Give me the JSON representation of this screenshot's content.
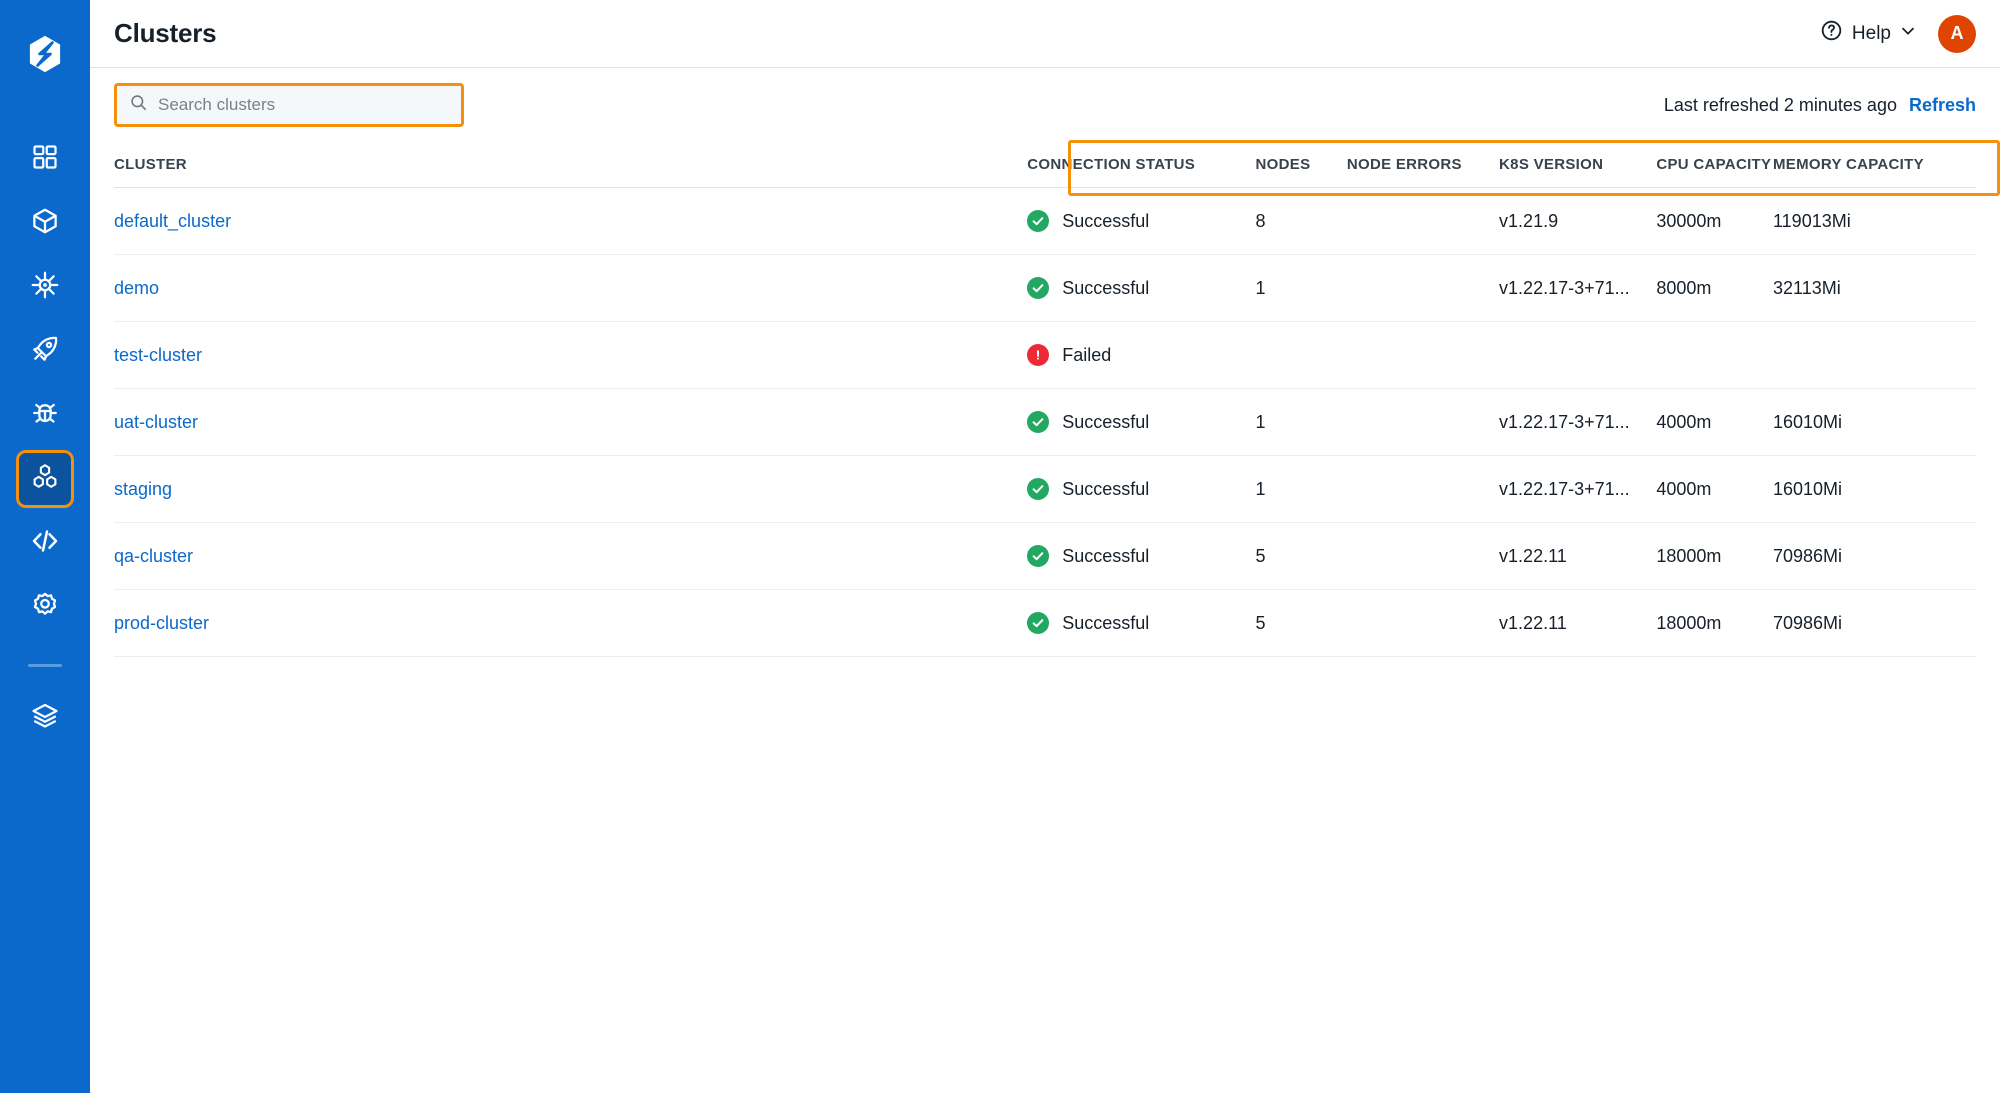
{
  "app": {
    "logo_icon": "hexagon-bolt-logo",
    "accent_blue": "#0b69cc",
    "highlight_orange": "#f5900c",
    "status_green": "#23a863",
    "status_red": "#ec2a37",
    "avatar_color": "#e04403"
  },
  "sidebar": {
    "items": [
      {
        "id": "dashboard",
        "icon": "grid-squares-icon",
        "active": false
      },
      {
        "id": "applications",
        "icon": "cube-icon",
        "active": false
      },
      {
        "id": "observe",
        "icon": "helm-wheel-icon",
        "active": false
      },
      {
        "id": "deploy",
        "icon": "rocket-icon",
        "active": false
      },
      {
        "id": "debug",
        "icon": "bug-icon",
        "active": false
      },
      {
        "id": "clusters",
        "icon": "hexagons-icon",
        "active": true
      },
      {
        "id": "code",
        "icon": "code-brackets-icon",
        "active": false
      },
      {
        "id": "settings",
        "icon": "gear-icon",
        "active": false
      },
      {
        "id": "stacks",
        "icon": "layers-icon",
        "active": false
      }
    ]
  },
  "header": {
    "title": "Clusters",
    "help_label": "Help",
    "help_icon": "question-circle-icon",
    "help_chevron_icon": "chevron-down-icon",
    "avatar_initial": "A"
  },
  "search": {
    "placeholder": "Search clusters",
    "value": "",
    "icon": "search-icon"
  },
  "refresh": {
    "last_refreshed_text": "Last refreshed 2 minutes ago",
    "refresh_label": "Refresh"
  },
  "table": {
    "columns": [
      {
        "key": "cluster",
        "label": "CLUSTER"
      },
      {
        "key": "connection",
        "label": "CONNECTION STATUS"
      },
      {
        "key": "nodes",
        "label": "NODES"
      },
      {
        "key": "node_errors",
        "label": "NODE ERRORS"
      },
      {
        "key": "k8s_version",
        "label": "K8S VERSION"
      },
      {
        "key": "cpu_capacity",
        "label": "CPU CAPACITY"
      },
      {
        "key": "memory_capacity",
        "label": "MEMORY CAPACITY"
      }
    ],
    "rows": [
      {
        "cluster": "default_cluster",
        "connection": "Successful",
        "status": "ok",
        "nodes": "8",
        "node_errors": "",
        "k8s_version": "v1.21.9",
        "cpu_capacity": "30000m",
        "memory_capacity": "119013Mi"
      },
      {
        "cluster": "demo",
        "connection": "Successful",
        "status": "ok",
        "nodes": "1",
        "node_errors": "",
        "k8s_version": "v1.22.17-3+71...",
        "cpu_capacity": "8000m",
        "memory_capacity": "32113Mi"
      },
      {
        "cluster": "test-cluster",
        "connection": "Failed",
        "status": "fail",
        "nodes": "",
        "node_errors": "",
        "k8s_version": "",
        "cpu_capacity": "",
        "memory_capacity": ""
      },
      {
        "cluster": "uat-cluster",
        "connection": "Successful",
        "status": "ok",
        "nodes": "1",
        "node_errors": "",
        "k8s_version": "v1.22.17-3+71...",
        "cpu_capacity": "4000m",
        "memory_capacity": "16010Mi"
      },
      {
        "cluster": "staging",
        "connection": "Successful",
        "status": "ok",
        "nodes": "1",
        "node_errors": "",
        "k8s_version": "v1.22.17-3+71...",
        "cpu_capacity": "4000m",
        "memory_capacity": "16010Mi"
      },
      {
        "cluster": "qa-cluster",
        "connection": "Successful",
        "status": "ok",
        "nodes": "5",
        "node_errors": "",
        "k8s_version": "v1.22.11",
        "cpu_capacity": "18000m",
        "memory_capacity": "70986Mi"
      },
      {
        "cluster": "prod-cluster",
        "connection": "Successful",
        "status": "ok",
        "nodes": "5",
        "node_errors": "",
        "k8s_version": "v1.22.11",
        "cpu_capacity": "18000m",
        "memory_capacity": "70986Mi"
      }
    ]
  }
}
